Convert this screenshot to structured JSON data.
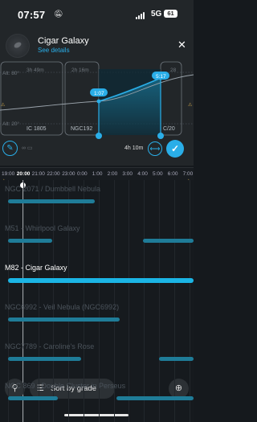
{
  "status_bar": {
    "time": "07:57",
    "network": "5G",
    "battery": "61"
  },
  "header": {
    "title": "Cigar Galaxy",
    "subtitle": "See details"
  },
  "chart": {
    "durations": [
      "3h 49m",
      "2h 16m",
      "28"
    ],
    "alt_max": "Alt: 80°",
    "alt_min": "Alt: 20°",
    "labels": [
      "IC 1805",
      "NGC192",
      "C/20"
    ],
    "points": [
      "1:07",
      "5:17"
    ],
    "total_duration": "4h 10m",
    "icon_glyph": "∞ ▭"
  },
  "timeline": {
    "hours": [
      "19:00",
      "20:00",
      "21:00",
      "22:00",
      "23:00",
      "0:00",
      "1:00",
      "2:00",
      "3:00",
      "4:00",
      "5:00",
      "6:00",
      "7:00"
    ],
    "highlight_hour": "20:00"
  },
  "targets": [
    {
      "label": "NGC 2071 / Dumbbell Nebula",
      "active": false,
      "bars": [
        [
          0.04,
          0.49
        ]
      ]
    },
    {
      "label": "M51 - Whirlpool Galaxy",
      "active": false,
      "bars": [
        [
          0.04,
          0.27
        ],
        [
          0.74,
          1.0
        ]
      ]
    },
    {
      "label": "M82 - Cigar Galaxy",
      "active": true,
      "bars": [
        [
          0.04,
          1.0
        ]
      ]
    },
    {
      "label": "NGC6992 - Veil Nebula (NGC6992)",
      "active": false,
      "bars": [
        [
          0.04,
          0.62
        ]
      ]
    },
    {
      "label": "NGC7789 - Caroline's Rose",
      "active": false,
      "bars": [
        [
          0.04,
          0.42
        ],
        [
          0.82,
          1.0
        ]
      ]
    },
    {
      "label": "NGC 869 - Double Cluster in Perseus",
      "active": false,
      "bars": [
        [
          0.04,
          0.3
        ],
        [
          0.6,
          1.0
        ]
      ]
    }
  ],
  "bottom_bar": {
    "sort_label": "Sort by grade"
  },
  "icons": {
    "avatar": "galaxy-avatar-icon",
    "close": "close-icon",
    "search": "search-icon",
    "sort": "sort-sliders-icon",
    "zoom": "zoom-in-icon"
  },
  "colors": {
    "accent": "#2aaee8",
    "bar": "#1f7c98",
    "bar_active": "#1bb5e5",
    "background": "#161a1e"
  }
}
